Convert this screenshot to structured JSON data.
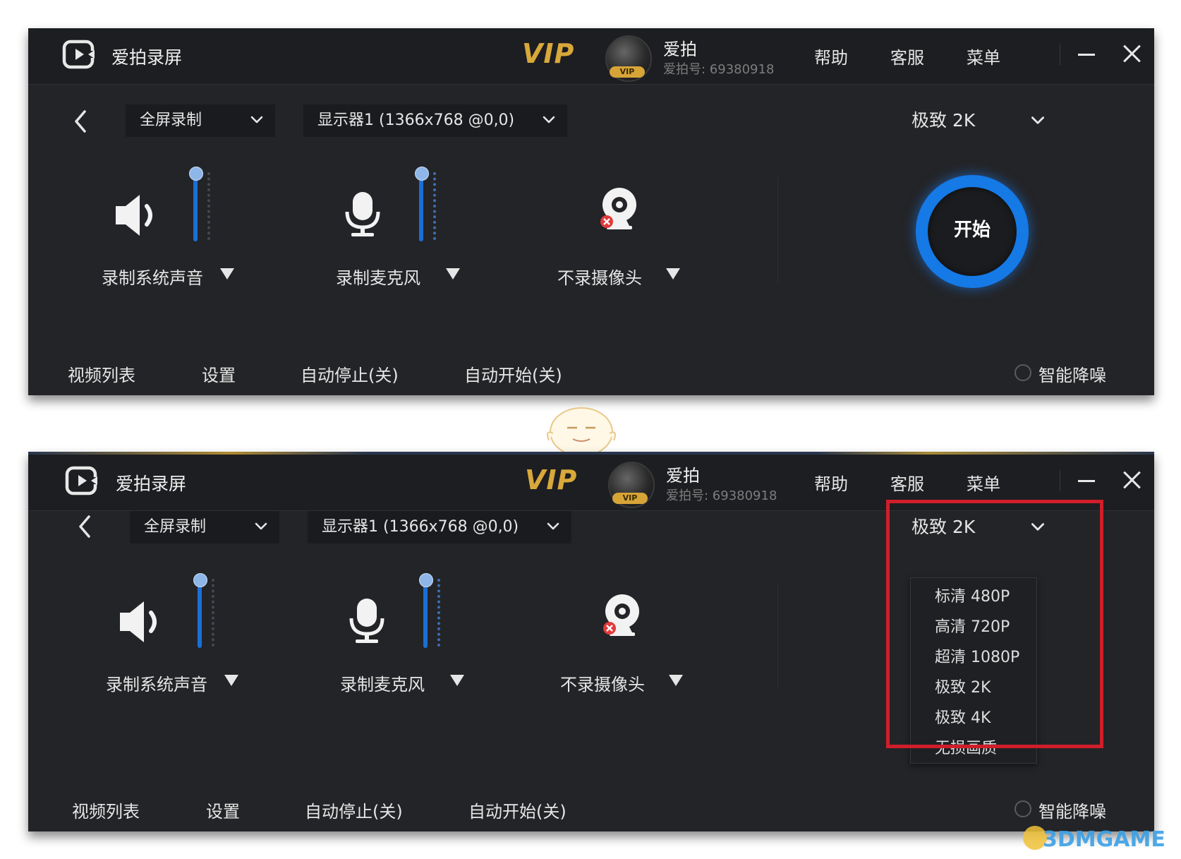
{
  "app": {
    "title": "爱拍录屏",
    "vip": "VIP",
    "user_name": "爱拍",
    "user_id": "爱拍号: 69380918",
    "avatar_badge": "VIP"
  },
  "titlebar": {
    "help": "帮助",
    "service": "客服",
    "menu": "菜单"
  },
  "toolbar": {
    "mode": "全屏录制",
    "display": "显示器1 (1366x768 @0,0)",
    "quality": "极致 2K"
  },
  "devices": {
    "system_audio": {
      "label": "录制系统声音",
      "volume_level": 1.0
    },
    "microphone": {
      "label": "录制麦克风",
      "volume_level": 1.0
    },
    "camera": {
      "label": "不录摄像头",
      "enabled": false
    }
  },
  "start_button": "开始",
  "bottom": {
    "video_list": "视频列表",
    "settings": "设置",
    "auto_stop": "自动停止(关)",
    "auto_start": "自动开始(关)",
    "noise_reduction": "智能降噪"
  },
  "quality_menu": [
    "标清 480P",
    "高清 720P",
    "超清 1080P",
    "极致 2K",
    "极致 4K",
    "无损画质"
  ],
  "watermark": "3DMGAME",
  "colors": {
    "accent": "#1579e6",
    "vip_gold": "#d8a83a",
    "highlight_red": "#d01e2a",
    "background": "#232427"
  }
}
